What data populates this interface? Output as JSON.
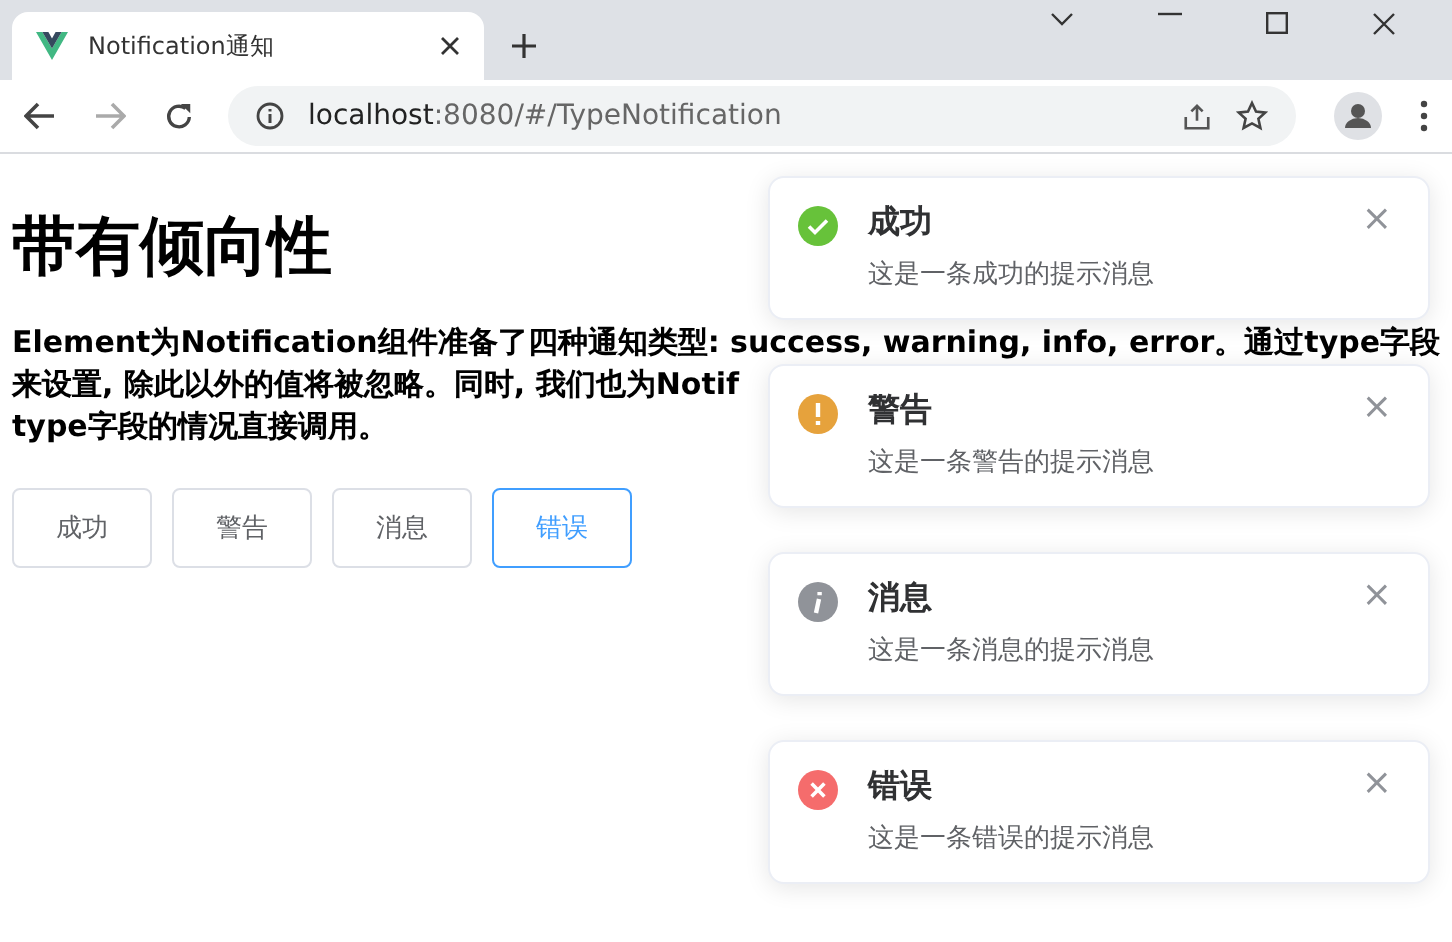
{
  "browser": {
    "tab_title": "Notification通知",
    "url_host": "localhost",
    "url_rest": ":8080/#/TypeNotification"
  },
  "page": {
    "heading": "带有倾向性",
    "paragraph_lines": [
      "Element为Notification组件准备了四种通知类型: success, warning, info, error。通过type字段",
      "来设置, 除此以外的值将被忽略。同时, 我们也为Notif",
      "type字段的情况直接调用。"
    ],
    "buttons": [
      {
        "label": "成功",
        "selected": false
      },
      {
        "label": "警告",
        "selected": false
      },
      {
        "label": "消息",
        "selected": false
      },
      {
        "label": "错误",
        "selected": true
      }
    ]
  },
  "notifications": [
    {
      "kind": "success",
      "title": "成功",
      "message": "这是一条成功的提示消息",
      "close": "×"
    },
    {
      "kind": "warning",
      "title": "警告",
      "message": "这是一条警告的提示消息",
      "close": "×"
    },
    {
      "kind": "info",
      "title": "消息",
      "message": "这是一条消息的提示消息",
      "close": "×"
    },
    {
      "kind": "error",
      "title": "错误",
      "message": "这是一条错误的提示消息",
      "close": "×"
    }
  ]
}
